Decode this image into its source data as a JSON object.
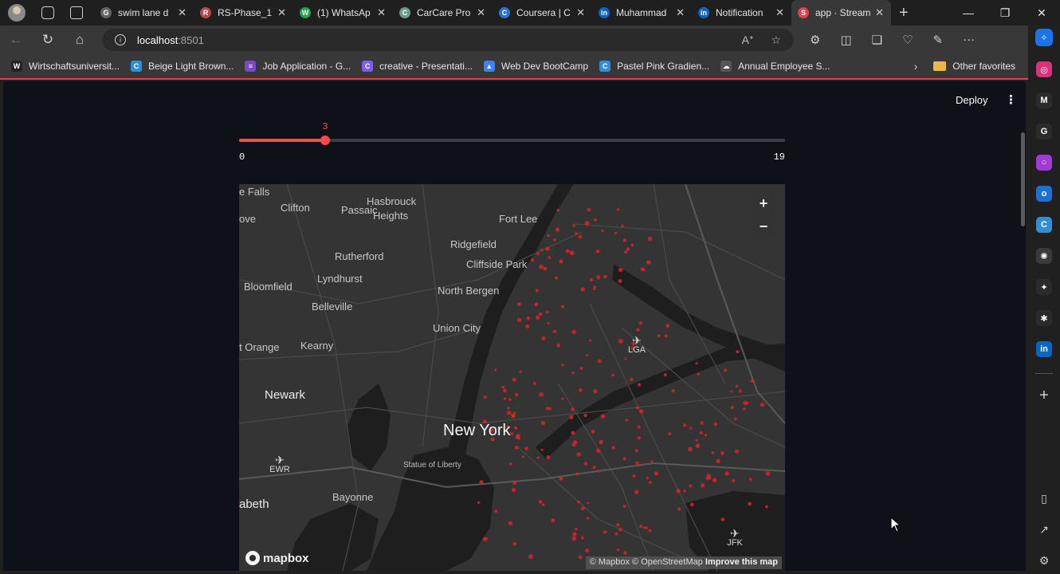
{
  "browser": {
    "tabs": [
      {
        "title": "swim lane d",
        "favicon": "G",
        "color": "#5f6368"
      },
      {
        "title": "RS-Phase_1",
        "favicon": "R",
        "color": "#b5484f"
      },
      {
        "title": "(1) WhatsAp",
        "favicon": "W",
        "color": "#25a244"
      },
      {
        "title": "CarCare Pro",
        "favicon": "C",
        "color": "#6b9a8f"
      },
      {
        "title": "Coursera | C",
        "favicon": "C",
        "color": "#2a73cc"
      },
      {
        "title": "Muhammad",
        "favicon": "in",
        "color": "#0a66c2"
      },
      {
        "title": "Notification",
        "favicon": "in",
        "color": "#0a66c2"
      },
      {
        "title": "app · Stream",
        "favicon": "S",
        "color": "#e0414a"
      }
    ],
    "active_tab_index": 7,
    "address": {
      "host": "localhost",
      "port": ":8501"
    },
    "bookmarks": [
      {
        "label": "Wirtschaftsuniversit...",
        "favicon": "W",
        "color": "#222"
      },
      {
        "label": "Beige Light Brown...",
        "favicon": "C",
        "color": "#2f8fd6"
      },
      {
        "label": "Job Application - G...",
        "favicon": "≡",
        "color": "#7a47c9"
      },
      {
        "label": "creative - Presentati...",
        "favicon": "C",
        "color": "#7c5cf5"
      },
      {
        "label": "Web Dev BootCamp",
        "favicon": "▲",
        "color": "#3b82f6"
      },
      {
        "label": "Pastel Pink Gradien...",
        "favicon": "C",
        "color": "#2f8fd6"
      },
      {
        "label": "Annual Employee S...",
        "favicon": "☁",
        "color": "#555"
      }
    ],
    "other_favorites": "Other favorites",
    "sidebar_icons": [
      {
        "name": "instagram-icon",
        "color": "#d6337a",
        "glyph": "◎"
      },
      {
        "name": "gmail-icon",
        "color": "#2b2b2b",
        "glyph": "M"
      },
      {
        "name": "google-icon",
        "color": "#2b2b2b",
        "glyph": "G"
      },
      {
        "name": "circle-app-icon",
        "color": "#a23ad6",
        "glyph": "○"
      },
      {
        "name": "outlook-icon",
        "color": "#1d6fd1",
        "glyph": "o"
      },
      {
        "name": "canva-icon",
        "color": "#2f8fd6",
        "glyph": "C"
      },
      {
        "name": "openai-icon",
        "color": "#3a3a3a",
        "glyph": "✺"
      },
      {
        "name": "gemini-icon",
        "color": "#2b2b2b",
        "glyph": "✦"
      },
      {
        "name": "perplexity-icon",
        "color": "#2b2b2b",
        "glyph": "✱"
      },
      {
        "name": "linkedin-icon",
        "color": "#0a66c2",
        "glyph": "in"
      }
    ]
  },
  "app": {
    "deploy_label": "Deploy",
    "slider": {
      "min": 0,
      "max": 19,
      "value": 3,
      "min_label": "0",
      "max_label": "19",
      "value_label": "3"
    },
    "map": {
      "zoom_in": "+",
      "zoom_out": "−",
      "brand": "mapbox",
      "attribution": "© Mapbox © OpenStreetMap",
      "improve": "Improve this map",
      "labels": {
        "falls": "e Falls",
        "clifton": "Clifton",
        "passaic": "Passaic",
        "hasbrouck": "Hasbrouck",
        "heights": "Heights",
        "fortlee": "Fort Lee",
        "ove": "ove",
        "ridgefield": "Ridgefield",
        "cliffside": "Cliffside Park",
        "rutherford": "Rutherford",
        "lyndhurst": "Lyndhurst",
        "bloomfield": "Bloomfield",
        "northbergen": "North Bergen",
        "belleville": "Belleville",
        "unioncity": "Union City",
        "orange": "t Orange",
        "kearny": "Kearny",
        "newark": "Newark",
        "newyork": "New York",
        "liberty": "Statue of Liberty",
        "bayonne": "Bayonne",
        "abeth": "abeth",
        "lga": "LGA",
        "ewr": "EWR",
        "jfk": "JFK"
      }
    }
  }
}
